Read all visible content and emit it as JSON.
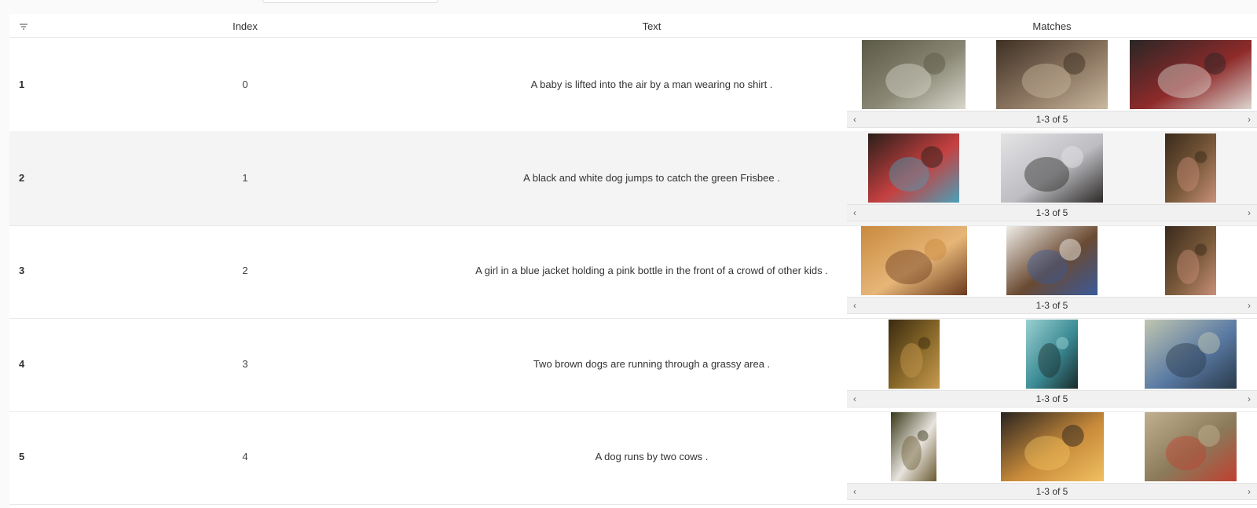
{
  "header": {
    "col_index": "Index",
    "col_text": "Text",
    "col_matches": "Matches"
  },
  "rows": [
    {
      "num": "1",
      "index": "0",
      "text": "A baby is lifted into the air by a man wearing no shirt .",
      "pager": "1-3 of 5",
      "matches": [
        {
          "icon": "boat-dock-photo",
          "w": 132,
          "colors": [
            "#5b5a47",
            "#8a8875",
            "#d9d7cc"
          ]
        },
        {
          "icon": "people-gathering-photo",
          "w": 142,
          "colors": [
            "#3d3024",
            "#8b7560",
            "#c9b8a0"
          ]
        },
        {
          "icon": "husky-dogs-photo",
          "w": 155,
          "colors": [
            "#2a2626",
            "#8e2a2a",
            "#dcd6d0"
          ]
        }
      ]
    },
    {
      "num": "2",
      "index": "1",
      "text": "A black and white dog jumps to catch the green Frisbee .",
      "pager": "1-3 of 5",
      "matches": [
        {
          "icon": "children-group-photo",
          "w": 116,
          "colors": [
            "#2a1f1a",
            "#c64040",
            "#4aa0b8"
          ]
        },
        {
          "icon": "dogs-in-snow-photo",
          "w": 130,
          "colors": [
            "#e4e4e6",
            "#bdbdc2",
            "#2d2a28"
          ]
        },
        {
          "icon": "child-at-cabinet-photo",
          "w": 65,
          "colors": [
            "#3a2a1c",
            "#7a5a3a",
            "#c98f7a"
          ]
        }
      ]
    },
    {
      "num": "3",
      "index": "2",
      "text": "A girl in a blue jacket holding a pink bottle in the front of a crowd of other kids .",
      "pager": "1-3 of 5",
      "matches": [
        {
          "icon": "dog-licking-girl-photo",
          "w": 135,
          "colors": [
            "#c98a3e",
            "#e6b678",
            "#6a3a1e"
          ]
        },
        {
          "icon": "puppy-and-child-photo",
          "w": 116,
          "colors": [
            "#f0ede8",
            "#6a4a32",
            "#3a5a9a"
          ]
        },
        {
          "icon": "child-at-cabinet-photo",
          "w": 65,
          "colors": [
            "#3a2a1c",
            "#7a5a3a",
            "#c98f7a"
          ]
        }
      ]
    },
    {
      "num": "4",
      "index": "3",
      "text": "Two brown dogs are running through a grassy area .",
      "pager": "1-3 of 5",
      "matches": [
        {
          "icon": "dog-running-photo",
          "w": 65,
          "colors": [
            "#3a2a10",
            "#8a6a2a",
            "#c89a50"
          ]
        },
        {
          "icon": "diver-jumping-photo",
          "w": 66,
          "colors": [
            "#9ad0d0",
            "#3a8a94",
            "#1a2a2a"
          ]
        },
        {
          "icon": "dog-in-puddle-photo",
          "w": 117,
          "colors": [
            "#c0c6b0",
            "#5a7aa4",
            "#2a3a4a"
          ]
        }
      ]
    },
    {
      "num": "5",
      "index": "4",
      "text": "A dog runs by two cows .",
      "pager": "1-3 of 5",
      "matches": [
        {
          "icon": "man-with-scarf-photo",
          "w": 58,
          "colors": [
            "#3a3a1a",
            "#e8e4de",
            "#6a5a30"
          ]
        },
        {
          "icon": "storefront-night-photo",
          "w": 131,
          "colors": [
            "#2a2420",
            "#c88a3a",
            "#f0c060"
          ]
        },
        {
          "icon": "dog-on-trail-photo",
          "w": 117,
          "colors": [
            "#c0b090",
            "#8a7a5a",
            "#c04030"
          ]
        }
      ]
    }
  ]
}
